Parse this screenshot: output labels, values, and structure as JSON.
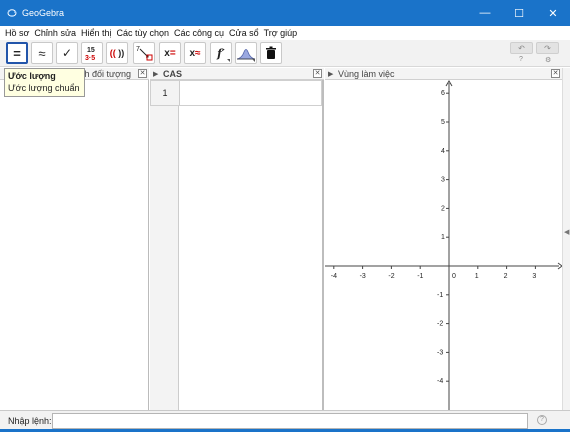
{
  "window": {
    "title": "GeoGebra",
    "minimize": "—",
    "maximize": "☐",
    "close": "✕"
  },
  "menu": [
    "Hồ sơ",
    "Chỉnh sửa",
    "Hiển thị",
    "Các tùy chọn",
    "Các công cụ",
    "Cửa sổ",
    "Trợ giúp"
  ],
  "toolbar": {
    "tools": [
      {
        "name": "evaluate-tool",
        "glyph": "="
      },
      {
        "name": "numeric-tool",
        "glyph": "≈"
      },
      {
        "name": "keep-input-tool",
        "glyph": "✓"
      },
      {
        "name": "factor-tool",
        "glyph": "15/3·5"
      },
      {
        "name": "expand-tool",
        "glyph": "(( ))"
      },
      {
        "name": "substitute-tool",
        "glyph": "7↘"
      },
      {
        "name": "solve-tool",
        "glyph": "x="
      },
      {
        "name": "solve-numerically-tool",
        "glyph": "x≈"
      },
      {
        "name": "derivative-tool",
        "glyph": "f′"
      },
      {
        "name": "probability-tool",
        "glyph": "△"
      },
      {
        "name": "delete-tool",
        "glyph": "🗑"
      }
    ],
    "undo": "↶",
    "redo": "↷",
    "help": "?",
    "settings": "⚙"
  },
  "tooltip": {
    "title": "Ước lượng",
    "subtitle": "Ước lượng chuẩn"
  },
  "panels": {
    "algebra": {
      "title": "Đại số / Danh sách đối tượng",
      "visible_title": "h đối tượng"
    },
    "cas": {
      "title": "CAS",
      "rows": [
        "1"
      ]
    },
    "graphics": {
      "title": "Vùng làm việc"
    }
  },
  "graph": {
    "x_ticks": [
      "-4",
      "-3",
      "-2",
      "-1",
      "0",
      "1",
      "2",
      "3"
    ],
    "y_ticks": [
      "6",
      "5",
      "4",
      "3",
      "2",
      "1",
      "-1",
      "-2",
      "-3",
      "-4"
    ]
  },
  "inputbar": {
    "label": "Nhập lệnh:",
    "value": "",
    "help": "?"
  },
  "colors": {
    "titlebar": "#1a73c9",
    "tooltip_bg": "#ffffe1",
    "active_tool_border": "#2255aa"
  }
}
